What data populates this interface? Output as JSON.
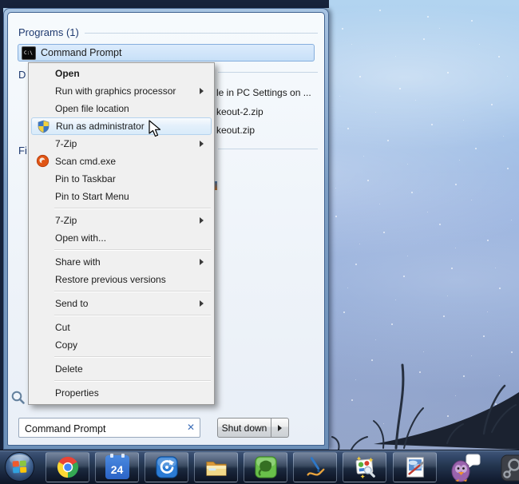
{
  "start_menu": {
    "programs_header": "Programs (1)",
    "selected_program": {
      "label": "Command Prompt",
      "cmd_icon_glyph": "C:\\"
    },
    "documents_header_fragment": "D",
    "files_header_fragment": "Fi",
    "covered_results": [
      "le in PC Settings on ...",
      "keout-2.zip",
      "keout.zip"
    ],
    "search": {
      "value": "Command Prompt",
      "clear_glyph": "✕"
    },
    "shutdown": {
      "label": "Shut down"
    }
  },
  "context_menu": {
    "items": [
      "Open",
      "Run with graphics processor",
      "Open file location",
      "Run as administrator",
      "7-Zip",
      "Scan cmd.exe",
      "Pin to Taskbar",
      "Pin to Start Menu",
      "7-Zip",
      "Open with...",
      "Share with",
      "Restore previous versions",
      "Send to",
      "Cut",
      "Copy",
      "Delete",
      "Properties"
    ]
  },
  "taskbar": {
    "calendar_day": "24",
    "apps": [
      "start",
      "chrome",
      "calendar",
      "sync",
      "explorer",
      "evernote",
      "pen",
      "photo-editor",
      "photo-viewer",
      "pidgin",
      "steam"
    ]
  },
  "colors": {
    "selection_border": "#86aedd",
    "menu_highlight_border": "#b5d3ee",
    "header_text": "#1f3a70",
    "desktop_sky_top": "#b2d4f0",
    "taskbar_dark": "#16202e"
  }
}
